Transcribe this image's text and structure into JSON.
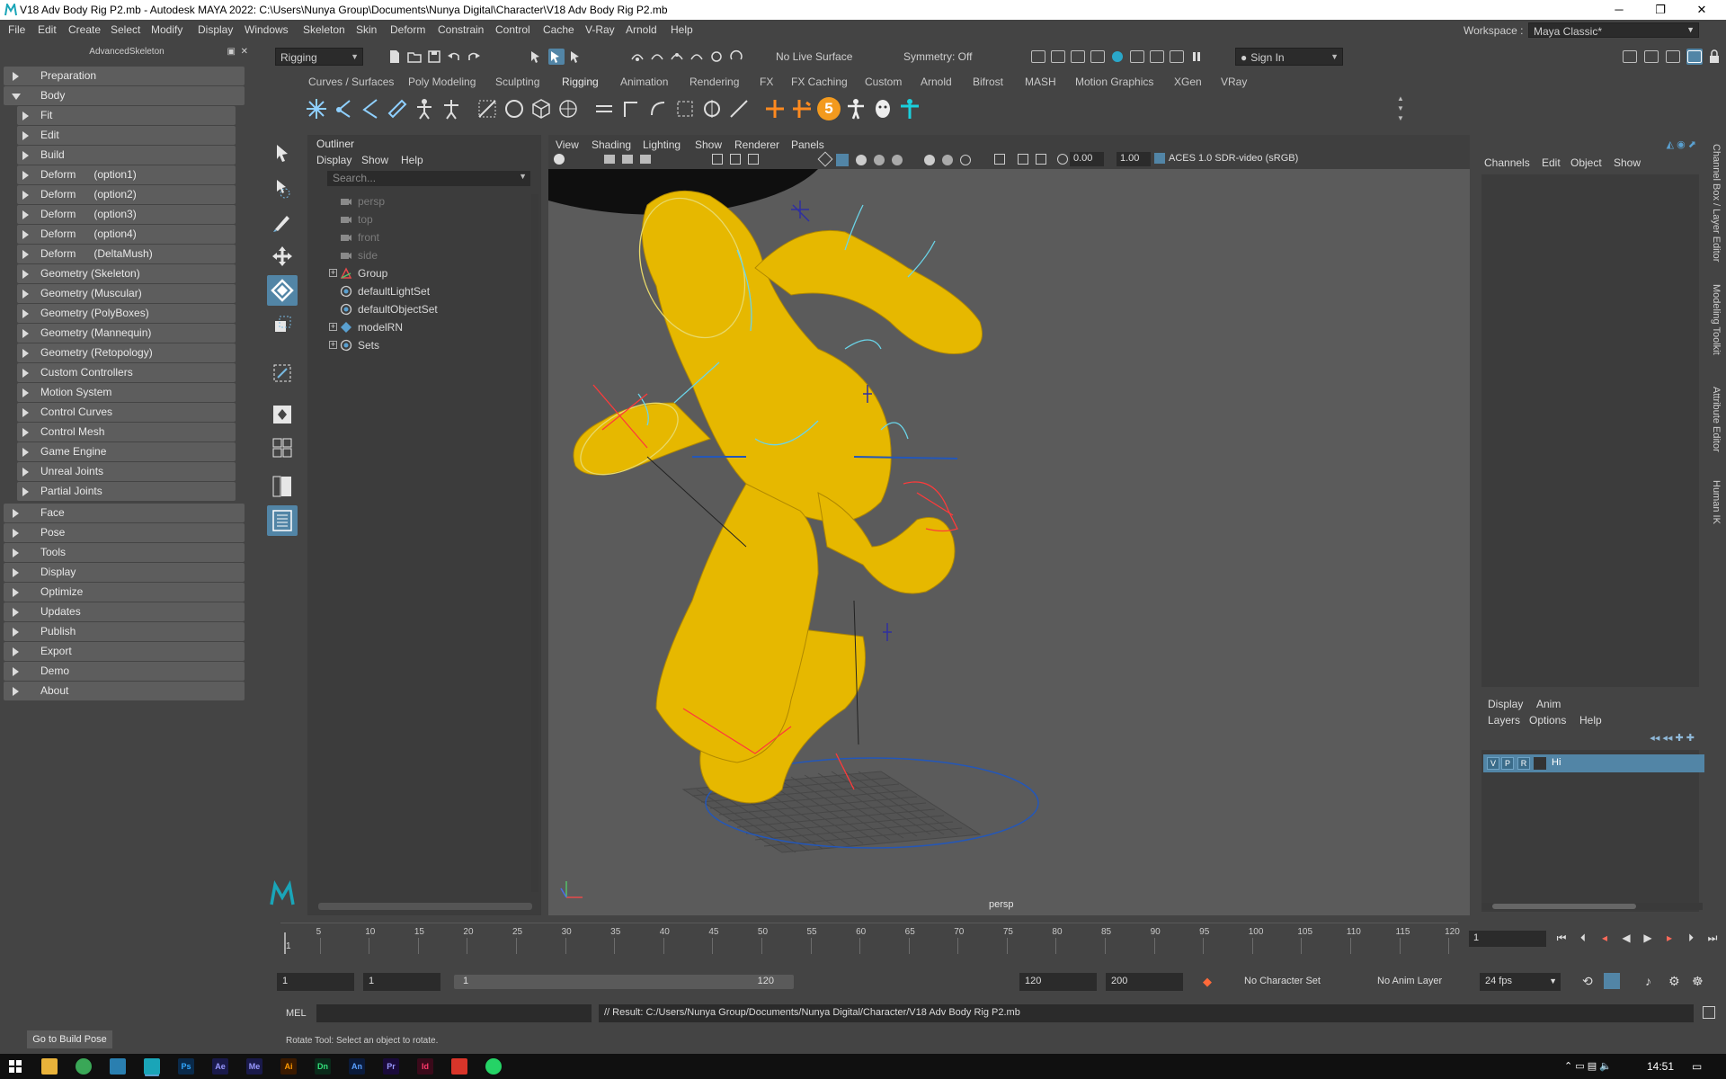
{
  "window": {
    "title": "V18 Adv Body Rig P2.mb - Autodesk MAYA 2022: C:\\Users\\Nunya Group\\Documents\\Nunya Digital\\Character\\V18 Adv Body Rig P2.mb",
    "minimize": "─",
    "maximize": "❐",
    "close": "✕"
  },
  "menubar": {
    "items": [
      "File",
      "Edit",
      "Create",
      "Select",
      "Modify",
      "Display",
      "Windows",
      "Skeleton",
      "Skin",
      "Deform",
      "Constrain",
      "Control",
      "Cache",
      "V-Ray",
      "Arnold",
      "Help"
    ],
    "workspace_label": "Workspace :",
    "workspace_value": "Maya Classic*"
  },
  "statusline": {
    "menuset": "Rigging",
    "live_surface": "No Live Surface",
    "symmetry": "Symmetry: Off",
    "sign_in": "Sign In"
  },
  "shelf": {
    "tabs": [
      "Curves / Surfaces",
      "Poly Modeling",
      "Sculpting",
      "Rigging",
      "Animation",
      "Rendering",
      "FX",
      "FX Caching",
      "Custom",
      "Arnold",
      "Bifrost",
      "MASH",
      "Motion Graphics",
      "XGen",
      "VRay"
    ],
    "active_tab": "Rigging",
    "badge_number": "5"
  },
  "advanced_skeleton": {
    "header": "AdvancedSkeleton",
    "sections_top": [
      "Preparation",
      "Body"
    ],
    "body_items": [
      "Fit",
      "Edit",
      "Build",
      "Deform      (option1)",
      "Deform      (option2)",
      "Deform      (option3)",
      "Deform      (option4)",
      "Deform      (DeltaMush)",
      "Geometry (Skeleton)",
      "Geometry (Muscular)",
      "Geometry (PolyBoxes)",
      "Geometry (Mannequin)",
      "Geometry (Retopology)",
      "Custom Controllers",
      "Motion System",
      "Control Curves",
      "Control Mesh",
      "Game Engine",
      "Unreal Joints",
      "Partial Joints"
    ],
    "sections_bottom": [
      "Face",
      "Pose",
      "Tools",
      "Display",
      "Optimize",
      "Updates",
      "Publish",
      "Export",
      "Demo",
      "About"
    ],
    "build_pose_button": "Go to Build Pose"
  },
  "outliner": {
    "title": "Outliner",
    "menu": [
      "Display",
      "Show",
      "Help"
    ],
    "search_placeholder": "Search...",
    "rows": [
      {
        "label": "persp",
        "icon": "camera-icon",
        "dim": true
      },
      {
        "label": "top",
        "icon": "camera-icon",
        "dim": true
      },
      {
        "label": "front",
        "icon": "camera-icon",
        "dim": true
      },
      {
        "label": "side",
        "icon": "camera-icon",
        "dim": true
      },
      {
        "label": "Group",
        "icon": "group-icon",
        "dim": false,
        "expandable": true
      },
      {
        "label": "defaultLightSet",
        "icon": "set-icon",
        "dim": false
      },
      {
        "label": "defaultObjectSet",
        "icon": "set-icon",
        "dim": false
      },
      {
        "label": "modelRN",
        "icon": "reference-icon",
        "dim": false,
        "expandable": true
      },
      {
        "label": "Sets",
        "icon": "set-icon",
        "dim": false,
        "expandable": true
      }
    ]
  },
  "viewport": {
    "menu": [
      "View",
      "Shading",
      "Lighting",
      "Show",
      "Renderer",
      "Panels"
    ],
    "exposure": "0.00",
    "gamma": "1.00",
    "color_space": "ACES 1.0 SDR-video (sRGB)",
    "camera_label": "persp",
    "mesh_color": "#e6b800"
  },
  "channel_box": {
    "menu": [
      "Channels",
      "Edit",
      "Object",
      "Show"
    ],
    "layer_tabs": [
      "Display",
      "Anim"
    ],
    "layer_menu": [
      "Layers",
      "Options",
      "Help"
    ],
    "layer": {
      "v": "V",
      "p": "P",
      "r": "R",
      "name": "Hi"
    }
  },
  "side_tabs": [
    "Channel Box / Layer Editor",
    "Modeling Toolkit",
    "Attribute Editor",
    "Human IK"
  ],
  "timeline": {
    "ticks": [
      "5",
      "10",
      "15",
      "20",
      "25",
      "30",
      "35",
      "40",
      "45",
      "50",
      "55",
      "60",
      "65",
      "70",
      "75",
      "80",
      "85",
      "90",
      "95",
      "100",
      "105",
      "110",
      "115",
      "120"
    ],
    "start_marker": "1",
    "current_frame": "1"
  },
  "range": {
    "start": "1",
    "inner_start": "1",
    "bar_start": "1",
    "bar_end": "120",
    "end": "120",
    "outer_end": "200",
    "character_set": "No Character Set",
    "anim_layer": "No Anim Layer",
    "fps": "24 fps"
  },
  "command_line": {
    "label": "MEL",
    "result": "// Result: C:/Users/Nunya Group/Documents/Nunya Digital/Character/V18 Adv Body Rig P2.mb"
  },
  "help_line": "Rotate Tool: Select an object to rotate.",
  "taskbar": {
    "apps": [
      "Ps",
      "Ae",
      "Me",
      "Ai",
      "Dn",
      "An",
      "Pr",
      "Id"
    ],
    "clock": "14:51"
  },
  "colors": {
    "accent": "#5285a6",
    "panel": "#444444",
    "field": "#2b2b2b",
    "viewport_bg": "#5b5b5b"
  }
}
